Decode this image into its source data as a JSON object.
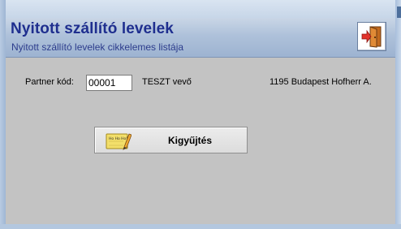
{
  "header": {
    "title": "Nyitott szállító levelek",
    "subtitle": "Nyitott szállító levelek cikkelemes listája"
  },
  "form": {
    "partner_label": "Partner kód:",
    "partner_code": "00001",
    "partner_name": "TESZT vevő",
    "partner_address": "1195 Budapest Hofherr A."
  },
  "actions": {
    "collect_label": "Kigyűjtés",
    "note_icon_text": "Ho Ho Ho!"
  },
  "icons": {
    "exit": "exit-door-icon",
    "collect": "notepad-pencil-icon"
  },
  "colors": {
    "title": "#1f2f8f",
    "header_bg": "#aec1da",
    "panel_bg": "#c3c3c3",
    "button_bg": "#dcdcdc"
  }
}
